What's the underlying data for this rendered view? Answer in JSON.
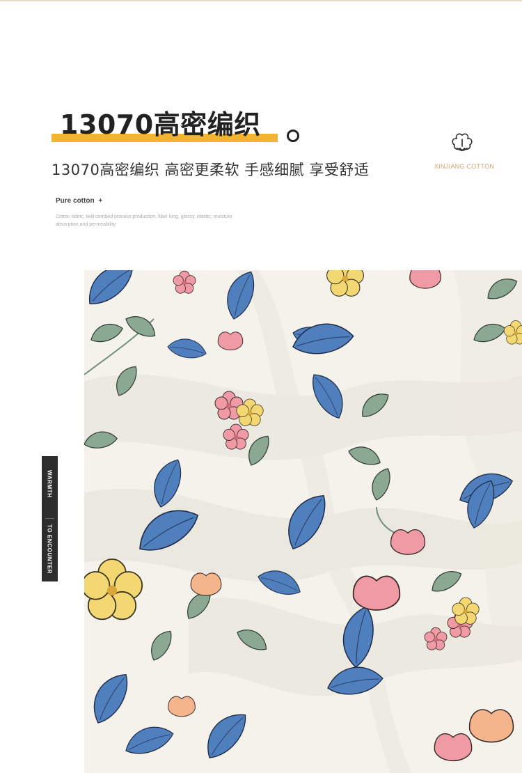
{
  "headline": "13070高密编织",
  "subtitle": "13070高密编织 高密更柔软 手感细腻 享受舒适",
  "brand": "XINJIANG COTTON",
  "pure_cotton_label": "Pure cotton",
  "plus_symbol": "+",
  "description": "Cotton fabric, twill combed process production, fiber long, glossy, elastic, moisture absorption and permeability",
  "tag": {
    "line1": "WARMTH",
    "line2": "TO ENCOUNTER"
  },
  "icons": {
    "cotton": "cotton-flower-icon",
    "plus": "plus-icon"
  },
  "colors": {
    "accent_bar": "#f2b532",
    "brand_text": "#c9a574",
    "tag_bg": "#2d2d2d",
    "fabric_bg": "#f4f2ea",
    "leaf_blue": "#4f7fbd",
    "leaf_green": "#8aa892",
    "flower_pink": "#ef9aa4",
    "flower_yellow": "#f3d772",
    "flower_peach": "#f4b48c"
  }
}
